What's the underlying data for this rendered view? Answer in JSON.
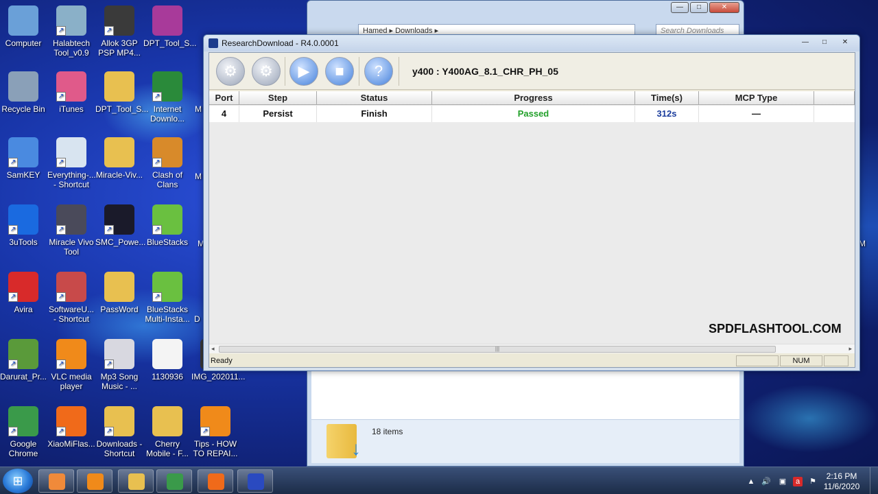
{
  "desktop": {
    "icons": [
      {
        "label": "Computer",
        "icon": "computer-icon",
        "color": "#6aa0d8",
        "shortcut": false
      },
      {
        "label": "Halabtech Tool_v0.9",
        "icon": "halabtech-icon",
        "color": "#8ab0c8",
        "shortcut": true
      },
      {
        "label": "Allok 3GP PSP MP4...",
        "icon": "allok-icon",
        "color": "#3a3a3a",
        "shortcut": true
      },
      {
        "label": "DPT_Tool_S...",
        "icon": "winrar-icon",
        "color": "#a83a9a",
        "shortcut": false
      },
      {
        "label": "Recycle Bin",
        "icon": "recycle-bin-icon",
        "color": "#8aa0b8",
        "shortcut": false
      },
      {
        "label": "iTunes",
        "icon": "itunes-icon",
        "color": "#e05a8a",
        "shortcut": true
      },
      {
        "label": "DPT_Tool_S...",
        "icon": "folder-icon",
        "color": "#e8c050",
        "shortcut": false
      },
      {
        "label": "Internet Downlo...",
        "icon": "idm-icon",
        "color": "#2a8a3a",
        "shortcut": true
      },
      {
        "label": "SamKEY",
        "icon": "samkey-icon",
        "color": "#4a8ae0",
        "shortcut": true
      },
      {
        "label": "Everything-... - Shortcut",
        "icon": "everything-icon",
        "color": "#d8e4f0",
        "shortcut": true
      },
      {
        "label": "Miracle-Viv...",
        "icon": "folder-icon",
        "color": "#e8c050",
        "shortcut": false
      },
      {
        "label": "Clash of Clans",
        "icon": "clash-of-clans-icon",
        "color": "#d88a2a",
        "shortcut": true
      },
      {
        "label": "3uTools",
        "icon": "3utools-icon",
        "color": "#1a6ae0",
        "shortcut": true
      },
      {
        "label": "Miracle Vivo Tool",
        "icon": "miracle-vivo-icon",
        "color": "#4a4a5a",
        "shortcut": true
      },
      {
        "label": "SMC_Powe...",
        "icon": "smc-power-icon",
        "color": "#1a1a2a",
        "shortcut": true
      },
      {
        "label": "BlueStacks",
        "icon": "bluestacks-icon",
        "color": "#6ac040",
        "shortcut": true
      },
      {
        "label": "Avira",
        "icon": "avira-icon",
        "color": "#d82a2a",
        "shortcut": true
      },
      {
        "label": "SoftwareU... - Shortcut",
        "icon": "software-update-icon",
        "color": "#c84a4a",
        "shortcut": true
      },
      {
        "label": "PassWord",
        "icon": "folder-icon",
        "color": "#e8c050",
        "shortcut": false
      },
      {
        "label": "BlueStacks Multi-Insta...",
        "icon": "bluestacks-multi-icon",
        "color": "#6ac040",
        "shortcut": true
      },
      {
        "label": "Darurat_Pr...",
        "icon": "android-icon",
        "color": "#5a9a3a",
        "shortcut": true
      },
      {
        "label": "VLC media player",
        "icon": "vlc-icon",
        "color": "#f08a1a",
        "shortcut": true
      },
      {
        "label": "Mp3 Song Music - ...",
        "icon": "mp3-song-icon",
        "color": "#d8d8e0",
        "shortcut": true
      },
      {
        "label": "1130936",
        "icon": "document-icon",
        "color": "#f4f4f4",
        "shortcut": false
      },
      {
        "label": "Google Chrome",
        "icon": "chrome-icon",
        "color": "#3a9a4a",
        "shortcut": true
      },
      {
        "label": "XiaoMiFlas...",
        "icon": "xiaomi-icon",
        "color": "#f06a1a",
        "shortcut": true
      },
      {
        "label": "Downloads - Shortcut",
        "icon": "downloads-folder-icon",
        "color": "#e8c050",
        "shortcut": true
      },
      {
        "label": "Cherry Mobile - F...",
        "icon": "folder-icon",
        "color": "#e8c050",
        "shortcut": false
      },
      {
        "label": "Tips - HOW TO REPAI...",
        "icon": "vlc-icon",
        "color": "#f08a1a",
        "shortcut": true
      },
      {
        "label": "IMG_202011...",
        "icon": "image-icon",
        "color": "#3a3a3a",
        "shortcut": false
      }
    ],
    "partial_labels": [
      "M",
      "M",
      "M",
      "D",
      "M"
    ]
  },
  "explorer": {
    "breadcrumb": [
      "Hamed",
      "Downloads"
    ],
    "search_placeholder": "Search Downloads",
    "items_count": "18 items"
  },
  "research_download": {
    "window_title": "ResearchDownload - R4.0.0001",
    "toolbar": {
      "buttons": [
        {
          "name": "settings",
          "icon": "gear-icon"
        },
        {
          "name": "multi-settings",
          "icon": "gears-icon"
        },
        {
          "name": "start",
          "icon": "play-icon"
        },
        {
          "name": "stop",
          "icon": "stop-icon"
        },
        {
          "name": "help",
          "icon": "help-icon"
        }
      ],
      "device_label": "y400 : Y400AG_8.1_CHR_PH_05"
    },
    "table": {
      "columns": [
        "Port",
        "Step",
        "Status",
        "Progress",
        "Time(s)",
        "MCP Type"
      ],
      "rows": [
        {
          "port": "4",
          "step": "Persist",
          "status": "Finish",
          "progress": "Passed",
          "time": "312s",
          "mcp_type": "—"
        }
      ]
    },
    "watermark": "SPDFLASHTOOL.COM",
    "statusbar": {
      "ready": "Ready",
      "num": "NUM"
    },
    "colors": {
      "passed": "#22a02a",
      "time": "#1a3c9c"
    }
  },
  "taskbar": {
    "items": [
      {
        "icon": "media-player-icon",
        "color": "#f08a3a"
      },
      {
        "icon": "vlc-icon",
        "color": "#f08a1a"
      },
      {
        "icon": "explorer-icon",
        "color": "#e8c050"
      },
      {
        "icon": "chrome-icon",
        "color": "#3a9a4a"
      },
      {
        "icon": "xiaomi-icon",
        "color": "#f06a1a"
      },
      {
        "icon": "research-download-icon",
        "color": "#2a4ac0"
      }
    ],
    "time": "2:16 PM",
    "date": "11/6/2020"
  }
}
